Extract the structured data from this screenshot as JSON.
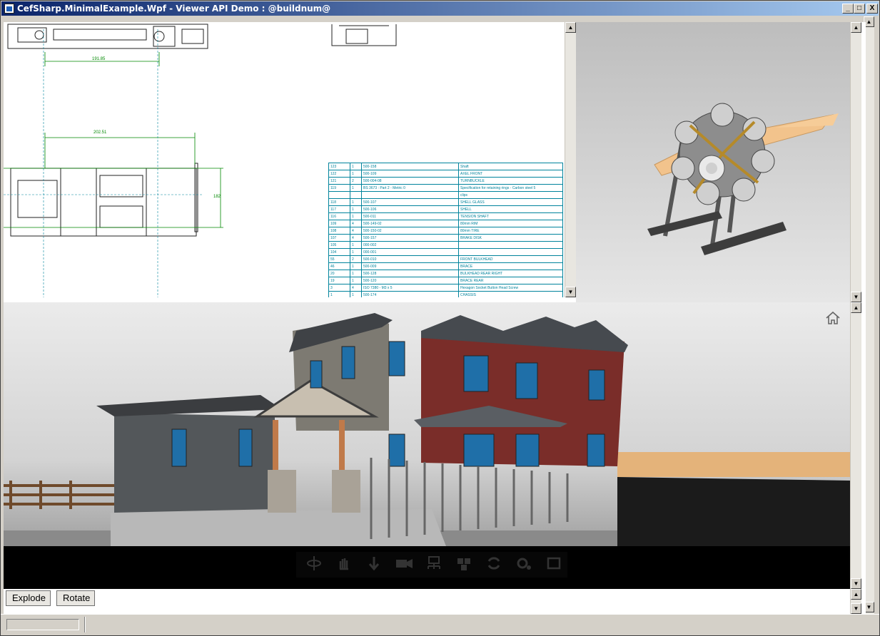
{
  "window": {
    "title": "CefSharp.MinimalExample.Wpf - Viewer API Demo : @buildnum@",
    "controls": {
      "minimize": "_",
      "maximize": "□",
      "close": "X"
    }
  },
  "drawing": {
    "dims": [
      "191.85",
      "202.51",
      "182"
    ],
    "bom_rows": [
      [
        "123",
        "1",
        "500-158",
        "Shaft"
      ],
      [
        "122",
        "1",
        "500-109",
        "AXEL FRONT"
      ],
      [
        "121",
        "2",
        "500-004-08",
        "TURNBUCKLE"
      ],
      [
        "119",
        "1",
        "BS 3673 : Part 2 - Metric 0",
        "Specification for retaining rings - Carbon steel 5"
      ],
      [
        "",
        "",
        "",
        "clips"
      ],
      [
        "118",
        "1",
        "500-107",
        "SHELL GLASS"
      ],
      [
        "117",
        "1",
        "500-106",
        "SHELL"
      ],
      [
        "116",
        "1",
        "500-011",
        "TENSION SHAFT"
      ],
      [
        "109",
        "4",
        "500-149-02",
        "80mm RIM"
      ],
      [
        "108",
        "4",
        "500-150-02",
        "80mm TIRE"
      ],
      [
        "107",
        "4",
        "500-157",
        "BRAKE DISK"
      ],
      [
        "105",
        "1",
        "000-002",
        ""
      ],
      [
        "104",
        "1",
        "000-001",
        ""
      ],
      [
        "55",
        "2",
        "500-010",
        "FRONT BULKHEAD"
      ],
      [
        "46",
        "1",
        "500-009",
        "BRACE"
      ],
      [
        "20",
        "1",
        "500-128",
        "BULKHEAD REAR RIGHT"
      ],
      [
        "19",
        "1",
        "500-120",
        "BRACE REAR"
      ],
      [
        "3",
        "4",
        "ISO 7380 - M3 x 5",
        "Hexagon Socket Button Head Screw"
      ],
      [
        "1",
        "1",
        "500-174",
        "CHASSIS"
      ]
    ]
  },
  "viewer_toolbar": {
    "tools": [
      "orbit-icon",
      "pan-icon",
      "zoom-icon",
      "camera-icon",
      "model-browser-icon",
      "explode-icon",
      "rotate-icon",
      "settings-icon",
      "fullscreen-icon"
    ]
  },
  "actions": {
    "explode_label": "Explode",
    "rotate_label": "Rotate"
  },
  "scroll": {
    "up": "▲",
    "down": "▼"
  },
  "colors": {
    "titlebar_start": "#0a246a",
    "titlebar_end": "#a6caf0",
    "drawing_line": "#00839c",
    "dim_line": "#008800"
  }
}
